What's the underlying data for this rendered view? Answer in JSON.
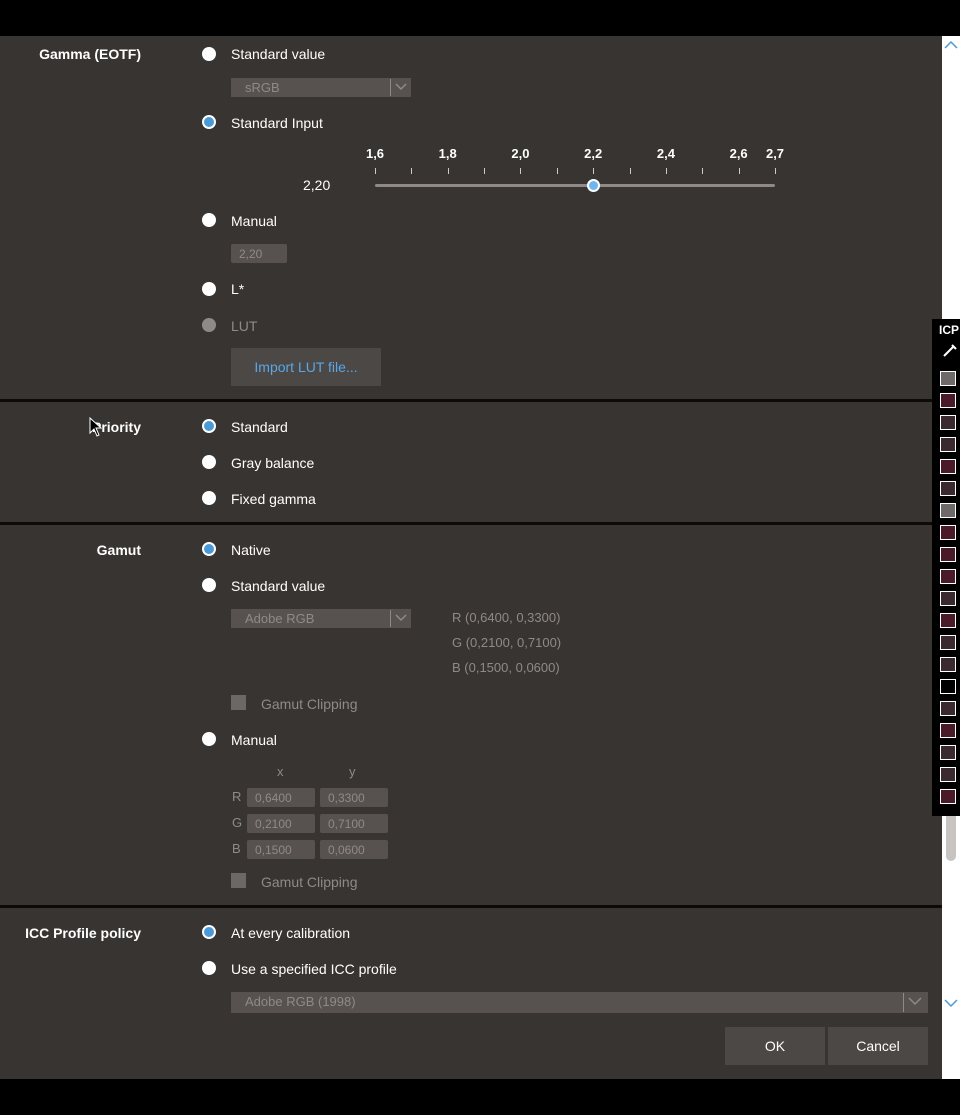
{
  "gamma": {
    "label": "Gamma (EOTF)",
    "options": {
      "standard_value": "Standard value",
      "standard_input": "Standard Input",
      "manual": "Manual",
      "lstar": "L*",
      "lut": "LUT"
    },
    "standard_value_select": "sRGB",
    "slider": {
      "value_text": "2,20",
      "min": 1.6,
      "max": 2.7,
      "value": 2.2,
      "tick_labels": [
        "1,6",
        "1,8",
        "2,0",
        "2,2",
        "2,4",
        "2,6",
        "2,7"
      ]
    },
    "manual_field": "2,20",
    "import_lut_button": "Import LUT file..."
  },
  "priority": {
    "label": "Priority",
    "options": [
      "Standard",
      "Gray balance",
      "Fixed gamma"
    ],
    "selected_index": 0
  },
  "gamut": {
    "label": "Gamut",
    "options": {
      "native": "Native",
      "standard_value": "Standard value",
      "manual": "Manual"
    },
    "standard_select": "Adobe RGB",
    "primaries": {
      "r": "R  (0,6400, 0,3300)",
      "g": "G  (0,2100, 0,7100)",
      "b": "B  (0,1500, 0,0600)"
    },
    "gamut_clipping": "Gamut Clipping",
    "manual_table": {
      "col_x": "x",
      "col_y": "y",
      "rows": [
        {
          "label": "R",
          "x": "0,6400",
          "y": "0,3300"
        },
        {
          "label": "G",
          "x": "0,2100",
          "y": "0,7100"
        },
        {
          "label": "B",
          "x": "0,1500",
          "y": "0,0600"
        }
      ]
    },
    "gamut_clipping_2": "Gamut Clipping"
  },
  "icc": {
    "label": "ICC Profile policy",
    "options": {
      "every": "At every calibration",
      "specified": "Use a specified ICC profile"
    },
    "profile_select": "Adobe RGB (1998)"
  },
  "buttons": {
    "ok": "OK",
    "cancel": "Cancel"
  },
  "palette": {
    "title": "ICP",
    "colors": [
      "#6e6a6a",
      "#4a1a28",
      "#3a2a30",
      "#3a2a30",
      "#4a1a28",
      "#3a2a30",
      "#6e6a6a",
      "#4a1a28",
      "#4a1a28",
      "#4a1a28",
      "#3a2a30",
      "#4a1a28",
      "#3a2a30",
      "#3a2a30",
      "#000000",
      "#3a2a30",
      "#4a1a28",
      "#3a2a30",
      "#3a2a30",
      "#4a1a28"
    ]
  }
}
